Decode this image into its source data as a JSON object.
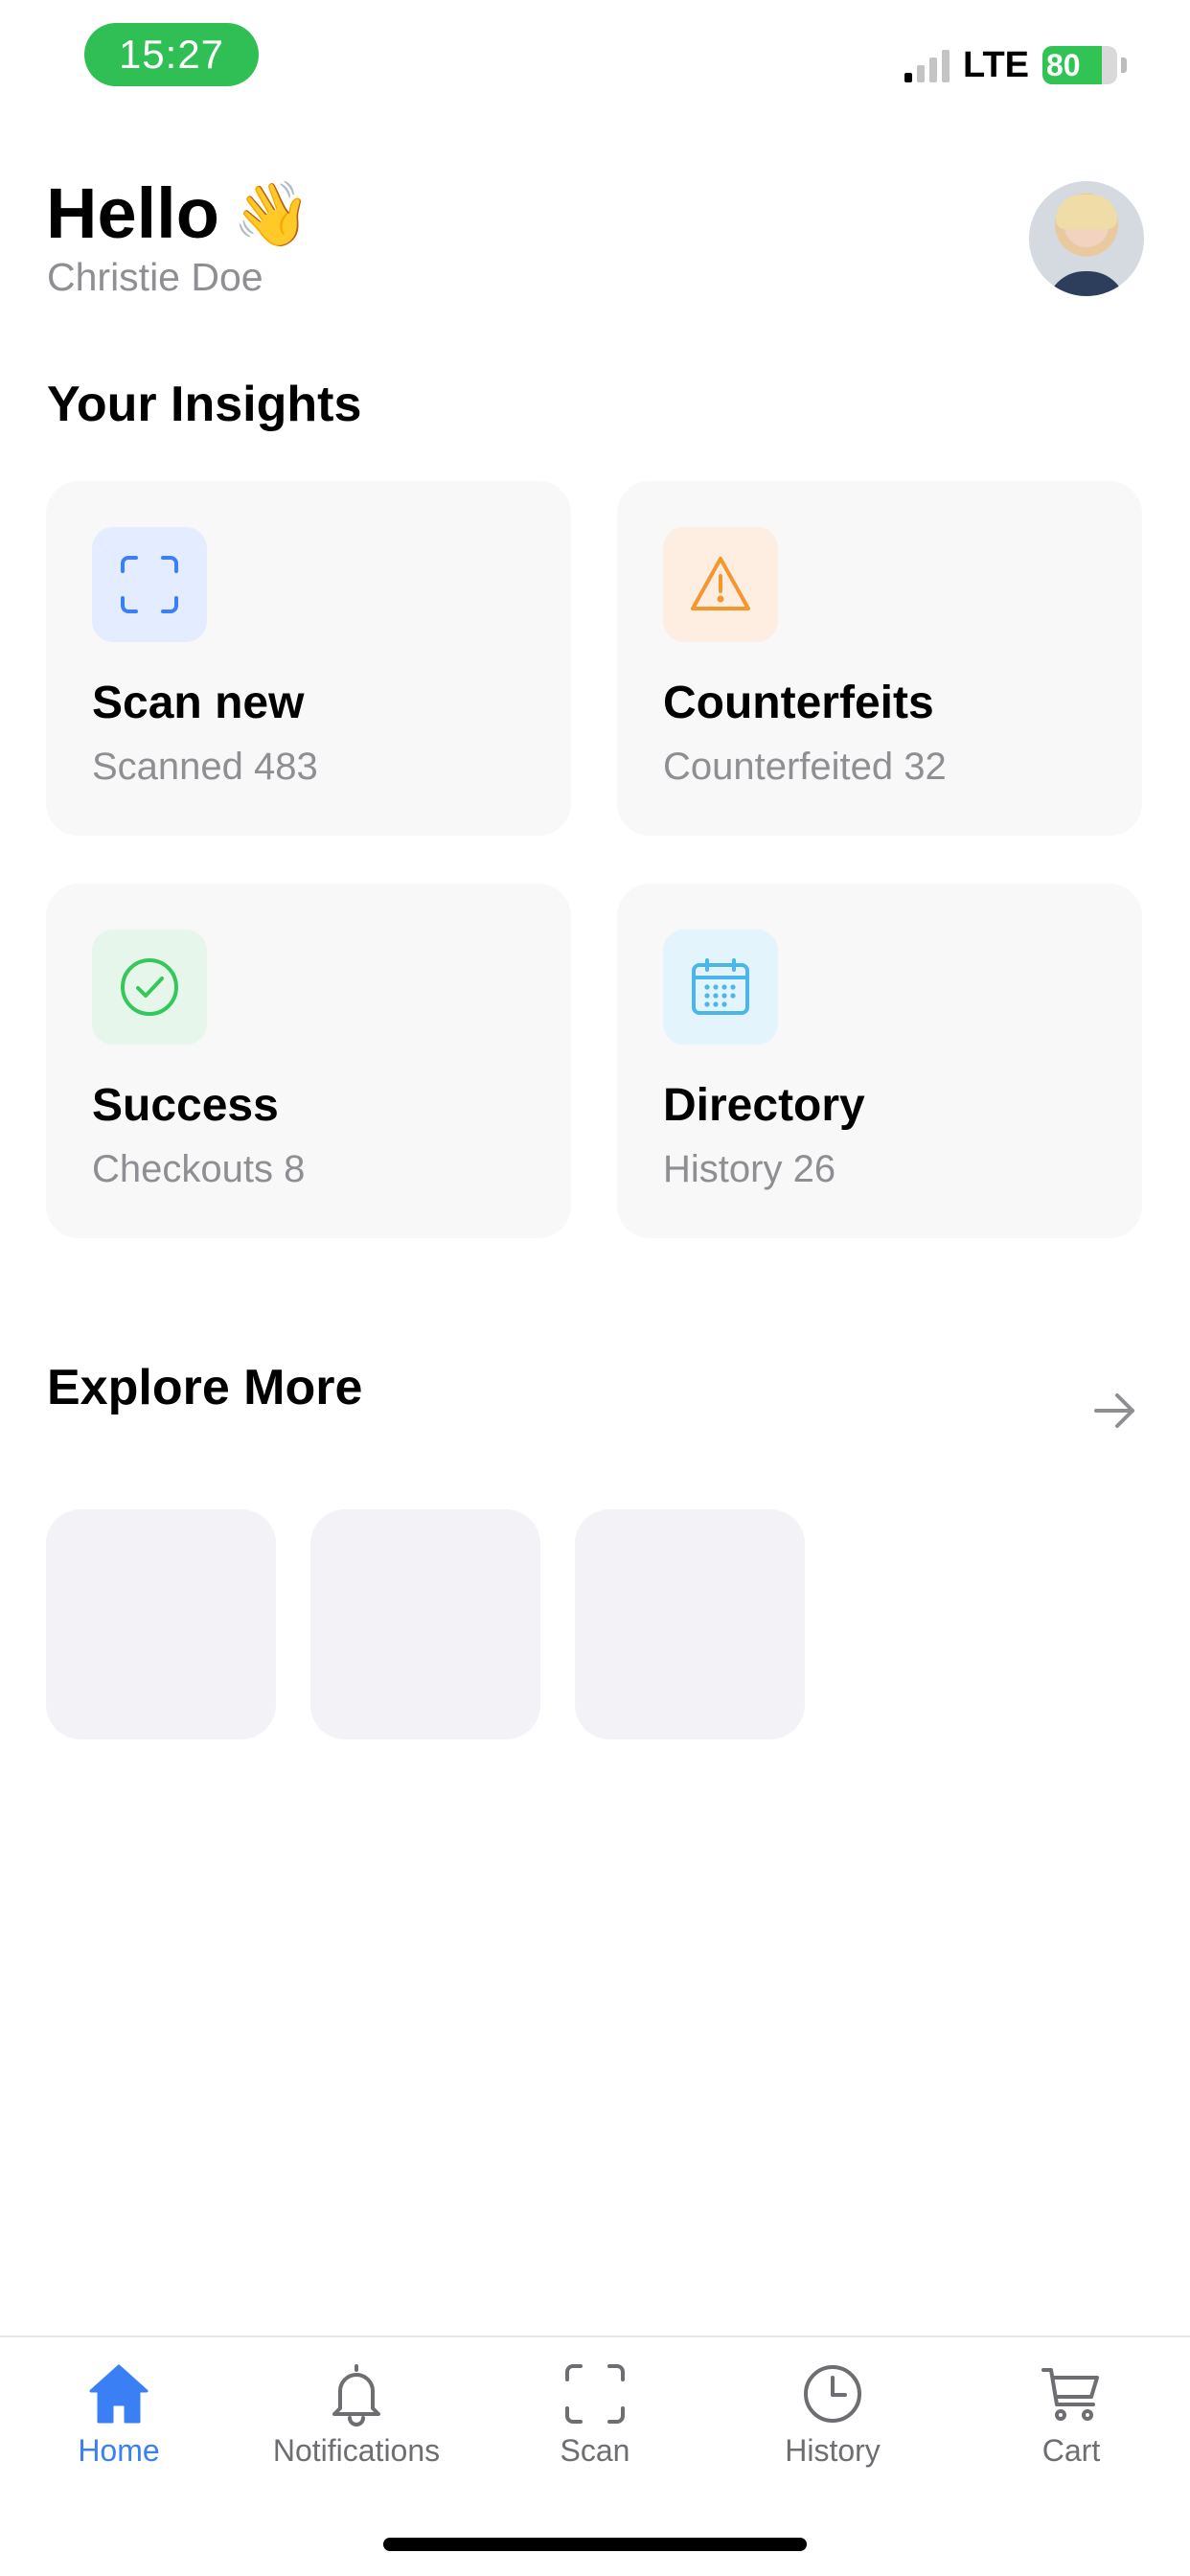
{
  "status_bar": {
    "time": "15:27",
    "network": "LTE",
    "battery_percent": "80",
    "battery_level": 0.8,
    "signal_bars_active": 1,
    "time_pill_color": "#2fbf54"
  },
  "header": {
    "greeting": "Hello",
    "wave_emoji": "👋",
    "user_name": "Christie Doe"
  },
  "insights": {
    "title": "Your Insights",
    "cards": [
      {
        "title": "Scan new",
        "subtitle": "Scanned 483",
        "icon": "scan-frame-icon",
        "accent": "#3b7ff5",
        "bg": "#e4edff"
      },
      {
        "title": "Counterfeits",
        "subtitle": "Counterfeited 32",
        "icon": "warning-triangle-icon",
        "accent": "#f5962e",
        "bg": "#fdeee1"
      },
      {
        "title": "Success",
        "subtitle": "Checkouts 8",
        "icon": "check-circle-icon",
        "accent": "#34c759",
        "bg": "#e6f6ea"
      },
      {
        "title": "Directory",
        "subtitle": "History 26",
        "icon": "calendar-icon",
        "accent": "#4bb6ec",
        "bg": "#e4f4fc"
      }
    ]
  },
  "explore": {
    "title": "Explore More",
    "arrow_icon": "arrow-right-icon"
  },
  "tabbar": {
    "tabs": [
      {
        "label": "Home",
        "icon": "home-icon",
        "active": true
      },
      {
        "label": "Notifications",
        "icon": "bell-icon",
        "active": false
      },
      {
        "label": "Scan",
        "icon": "scan-frame-icon",
        "active": false
      },
      {
        "label": "History",
        "icon": "clock-icon",
        "active": false
      },
      {
        "label": "Cart",
        "icon": "cart-icon",
        "active": false
      }
    ],
    "active_color": "#3b7ff5",
    "inactive_color": "#6d6d72"
  }
}
